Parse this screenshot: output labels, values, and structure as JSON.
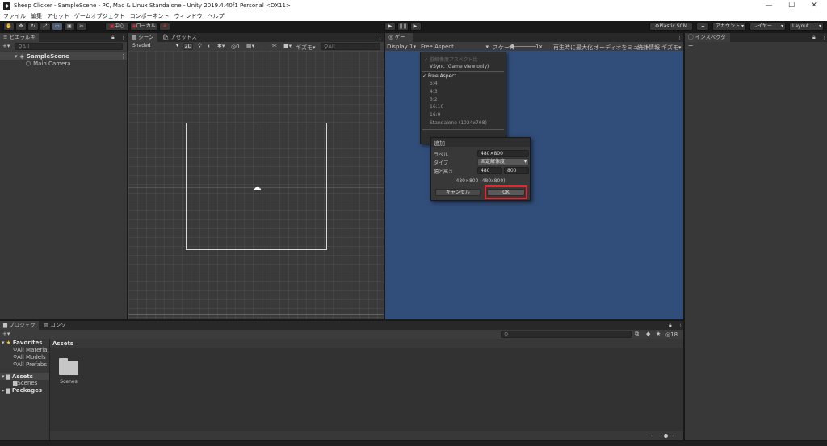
{
  "window": {
    "title": "Sheep Clicker - SampleScene - PC, Mac & Linux Standalone - Unity 2019.4.40f1 Personal <DX11>",
    "minimize": "—",
    "maximize": "☐",
    "close": "✕"
  },
  "menu": [
    "ファイル",
    "編集",
    "アセット",
    "ゲームオブジェクト",
    "コンポーネント",
    "ウィンドウ",
    "ヘルプ"
  ],
  "toolbar": {
    "pivot_label": "中心",
    "space_label": "ローカル",
    "plastic_label": "Plastic SCM",
    "account_label": "アカウント",
    "layers_label": "レイヤー",
    "layout_label": "Layout"
  },
  "hierarchy": {
    "tab_label": "ヒエラルキー",
    "search_placeholder": "All",
    "scene_name": "SampleScene",
    "items": [
      "Main Camera"
    ]
  },
  "scene": {
    "tab_label": "シーン",
    "asset_store_tab": "アセットストア",
    "shading_mode": "Shaded",
    "mode_2d": "2D",
    "hidden_count": "0",
    "gizmos_label": "ギズモ",
    "search_placeholder": "All"
  },
  "game": {
    "tab_label": "ゲーム",
    "display": "Display 1",
    "aspect": "Free Aspect",
    "scale_label": "スケール",
    "scale_value": "1x",
    "maximize_on_play": "再生時に最大化",
    "mute_audio": "オーディオをミュート",
    "stats": "統計情報",
    "gizmos": "ギズモ"
  },
  "aspect_menu": {
    "low_res": "低解像度アスペクト比",
    "vsync": "VSync (Game view only)",
    "options": [
      "Free Aspect",
      "5:4",
      "4:3",
      "3:2",
      "16:10",
      "16:9",
      "Standalone (1024x768)"
    ]
  },
  "add_dialog": {
    "title": "追加",
    "label_label": "ラベル",
    "label_value": "480×800",
    "type_label": "タイプ",
    "type_value": "固定解像度",
    "size_label": "幅と高さ",
    "width": "480",
    "height": "800",
    "summary": "480×800 (480x800)",
    "cancel_label": "キャンセル",
    "ok_label": "OK"
  },
  "inspector": {
    "tab_label": "インスペクター"
  },
  "project": {
    "tab_label": "プロジェクト",
    "console_tab": "コンソール",
    "favorites_label": "Favorites",
    "favorites": [
      "All Materials",
      "All Models",
      "All Prefabs"
    ],
    "assets_label": "Assets",
    "assets_children": [
      "Scenes"
    ],
    "packages_label": "Packages",
    "breadcrumb": "Assets",
    "items": [
      "Scenes"
    ],
    "hidden_count": "18"
  },
  "colors": {
    "game_bg": "#314d79",
    "ok_highlight": "#e0282e",
    "editor_bg": "#383838"
  }
}
